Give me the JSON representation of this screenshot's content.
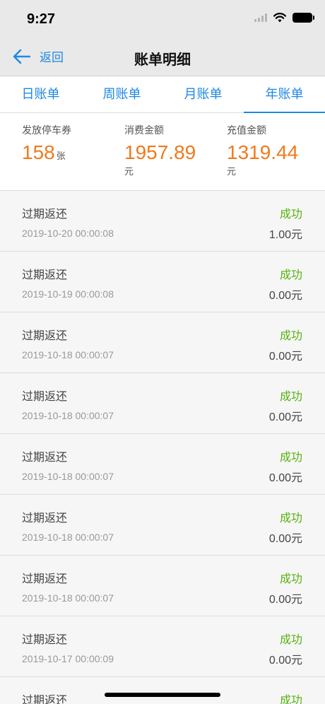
{
  "status_bar": {
    "time": "9:27"
  },
  "navbar": {
    "back_label": "返回",
    "title": "账单明细"
  },
  "tabs": [
    {
      "label": "日账单",
      "active": false
    },
    {
      "label": "周账单",
      "active": false
    },
    {
      "label": "月账单",
      "active": false
    },
    {
      "label": "年账单",
      "active": true
    }
  ],
  "summary": {
    "coupons": {
      "label": "发放停车券",
      "value": "158",
      "unit": "张"
    },
    "consumption": {
      "label": "消费金额",
      "value": "1957.89",
      "unit": "元"
    },
    "recharge": {
      "label": "充值金额",
      "value": "1319.44",
      "unit": "元"
    }
  },
  "records": [
    {
      "title": "过期返还",
      "time": "2019-10-20 00:00:08",
      "status": "成功",
      "amount": "1.00元"
    },
    {
      "title": "过期返还",
      "time": "2019-10-19 00:00:08",
      "status": "成功",
      "amount": "0.00元"
    },
    {
      "title": "过期返还",
      "time": "2019-10-18 00:00:07",
      "status": "成功",
      "amount": "0.00元"
    },
    {
      "title": "过期返还",
      "time": "2019-10-18 00:00:07",
      "status": "成功",
      "amount": "0.00元"
    },
    {
      "title": "过期返还",
      "time": "2019-10-18 00:00:07",
      "status": "成功",
      "amount": "0.00元"
    },
    {
      "title": "过期返还",
      "time": "2019-10-18 00:00:07",
      "status": "成功",
      "amount": "0.00元"
    },
    {
      "title": "过期返还",
      "time": "2019-10-18 00:00:07",
      "status": "成功",
      "amount": "0.00元"
    },
    {
      "title": "过期返还",
      "time": "2019-10-17 00:00:09",
      "status": "成功",
      "amount": "0.00元"
    },
    {
      "title": "过期返还",
      "time": "",
      "status": "成功",
      "amount": ""
    }
  ],
  "colors": {
    "accent": "#1e88e5",
    "orange": "#f07a1d",
    "success": "#56b10f"
  }
}
